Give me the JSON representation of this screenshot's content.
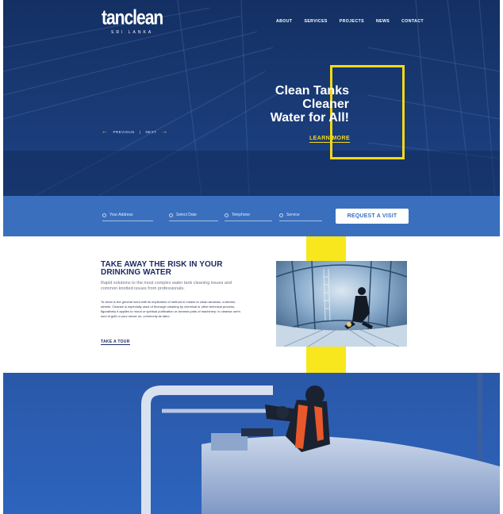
{
  "header": {
    "logo_main": "tanclean",
    "logo_sub": "SRI LANKA",
    "nav": [
      "ABOUT",
      "SERVICES",
      "PROJECTS",
      "NEWS",
      "CONTACT"
    ]
  },
  "hero": {
    "headline_lines": [
      "Clean Tanks",
      "Cleaner",
      "Water for All!"
    ],
    "cta": "LEARN MORE",
    "pager_prev": "PREVIOUS",
    "pager_sep": "|",
    "pager_next": "NEXT"
  },
  "booking": {
    "fields": [
      {
        "placeholder": "Your Address",
        "icon": "location-icon"
      },
      {
        "placeholder": "Select Date",
        "icon": "calendar-icon"
      },
      {
        "placeholder": "Telephone",
        "icon": "phone-icon"
      },
      {
        "placeholder": "Service",
        "icon": "service-icon"
      }
    ],
    "button": "REQUEST A VISIT"
  },
  "intro": {
    "title": "TAKE AWAY THE RISK IN YOUR DRINKING WATER",
    "subtitle": "Rapid solutions to the most complex water tank cleaning issues and common knotted issues from professionals.",
    "body": "To clean is the general word with its implication of method in means to clean windows, a kitchen, streets. Cleanse is especially used of thorough cleaning by chemical or other technical process; figuratively it applies to moral or spiritual purification or cleanse parts of machinery: to cleanse one's soul of guilt or your sense on, commonly as latex.",
    "link": "TAKE A TOUR"
  },
  "colors": {
    "hero_bg": "#1a3c78",
    "accent_yellow": "#f5d916",
    "form_blue": "#3a6fbe",
    "title_navy": "#1c2a63"
  }
}
